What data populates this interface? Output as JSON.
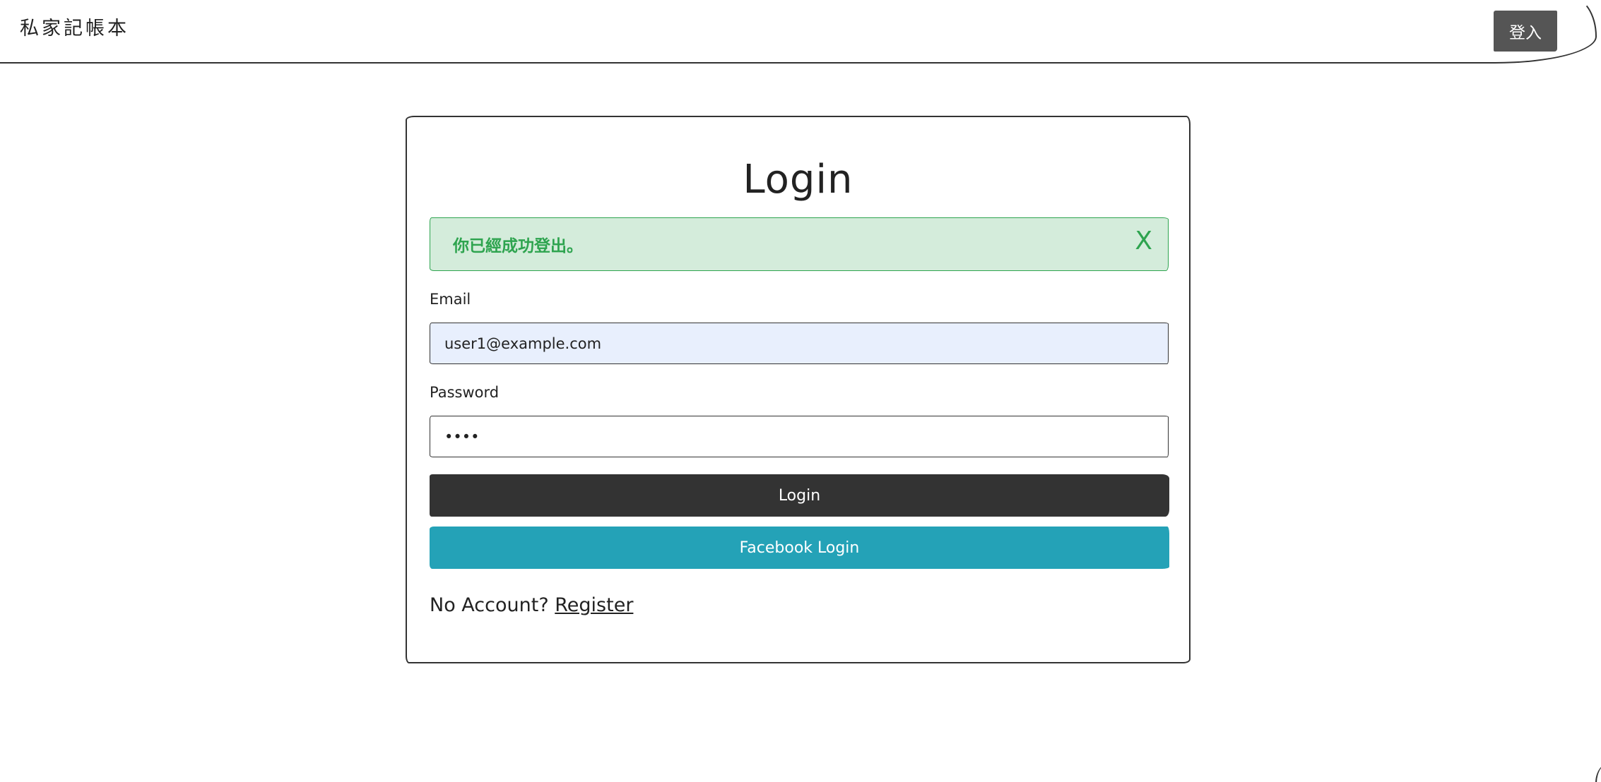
{
  "navbar": {
    "brand": "私家記帳本",
    "login_button": "登入"
  },
  "login_card": {
    "title": "Login",
    "alert": {
      "message": "你已經成功登出。",
      "close_label": "X",
      "color": "#2ea44f"
    },
    "email": {
      "label": "Email",
      "value": "user1@example.com"
    },
    "password": {
      "label": "Password",
      "value": "••••"
    },
    "login_button": "Login",
    "facebook_button": "Facebook Login",
    "register_prompt": "No Account?",
    "register_link": "Register"
  },
  "colors": {
    "primary_button": "#333333",
    "facebook_button": "#24a2b7",
    "alert_background": "#d4ecdb",
    "email_input_background": "#e8effd"
  }
}
